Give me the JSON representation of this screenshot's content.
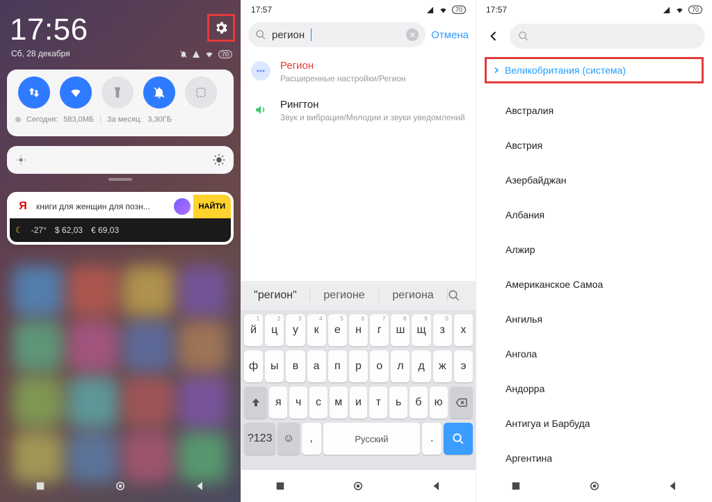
{
  "panel1": {
    "time": "17:56",
    "date": "Сб, 28 декабря",
    "battery": "70",
    "data_usage": {
      "today_label": "Сегодня:",
      "today": "583,0МБ",
      "month_label": "За месяц:",
      "month": "3,30ГБ"
    },
    "yandex": {
      "logo": "Я",
      "query": "книги для женщин для позн...",
      "find": "НАЙТИ",
      "temp": "-27°",
      "usd": "$ 62,03",
      "eur": "€ 69,03"
    }
  },
  "panel2": {
    "time": "17:57",
    "battery": "70",
    "search_value": "регион",
    "cancel": "Отмена",
    "results": [
      {
        "title": "Регион",
        "sub": "Расширенные настройки/Регион",
        "highlight": true
      },
      {
        "title": "Рингтон",
        "sub": "Звук и вибрация/Мелодии и звуки уведомлений",
        "highlight": false
      }
    ],
    "suggestions": [
      "\"регион\"",
      "регионе",
      "региона"
    ],
    "keyboard": {
      "row1": [
        "й",
        "ц",
        "у",
        "к",
        "е",
        "н",
        "г",
        "ш",
        "щ",
        "з",
        "х"
      ],
      "row1nums": [
        "1",
        "2",
        "3",
        "4",
        "5",
        "6",
        "7",
        "8",
        "9",
        "0",
        ""
      ],
      "row2": [
        "ф",
        "ы",
        "в",
        "а",
        "п",
        "р",
        "о",
        "л",
        "д",
        "ж",
        "э"
      ],
      "row3": [
        "я",
        "ч",
        "с",
        "м",
        "и",
        "т",
        "ь",
        "б",
        "ю"
      ],
      "sym": "?123",
      "lang": "Русский"
    }
  },
  "panel3": {
    "time": "17:57",
    "battery": "70",
    "selected": "Великобритания (система)",
    "regions": [
      "Австралия",
      "Австрия",
      "Азербайджан",
      "Албания",
      "Алжир",
      "Американское Самоа",
      "Ангилья",
      "Ангола",
      "Андорра",
      "Антигуа и Барбуда",
      "Аргентина"
    ]
  }
}
